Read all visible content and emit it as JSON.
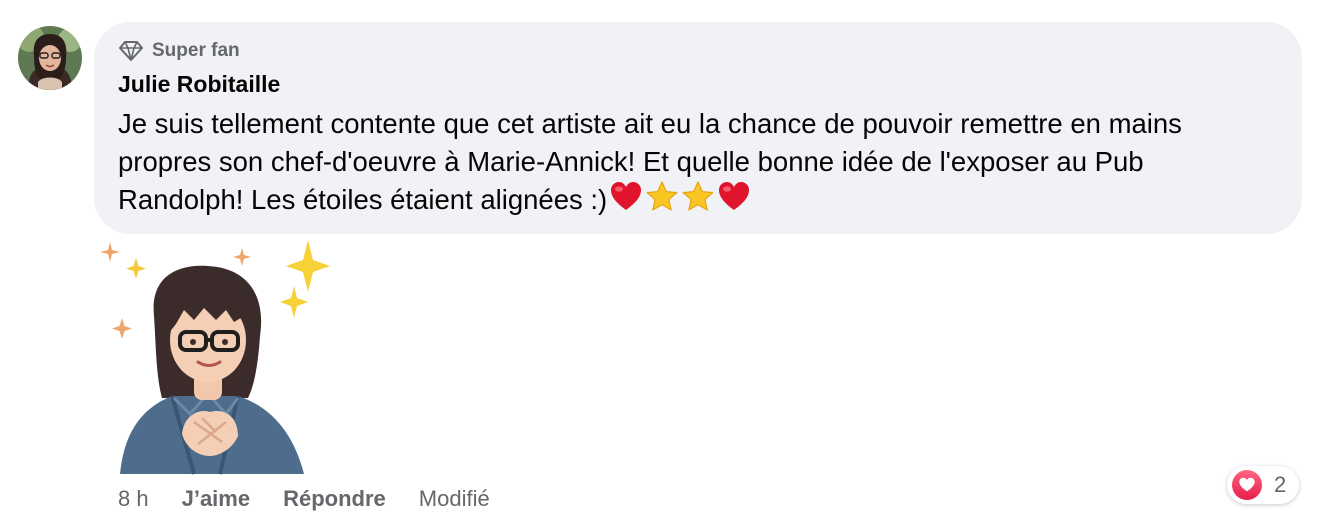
{
  "comment": {
    "badge_label": "Super fan",
    "author": "Julie Robitaille",
    "text": "Je suis tellement contente que cet artiste ait eu la chance de pouvoir remettre en mains propres son chef-d'oeuvre à Marie-Annick! Et quelle bonne idée de l'exposer au Pub Randolph! Les étoiles étaient alignées :)",
    "trailing_emojis": [
      "red-heart",
      "star",
      "star",
      "red-heart"
    ]
  },
  "actions": {
    "timestamp": "8 h",
    "like_label": "J’aime",
    "reply_label": "Répondre",
    "edited_label": "Modifié"
  },
  "reactions": {
    "type": "love",
    "count": "2"
  },
  "colors": {
    "bubble_bg": "#f0f2f5",
    "secondary_text": "#65676b",
    "love": "#e61e4d",
    "star": "#f9c623"
  }
}
